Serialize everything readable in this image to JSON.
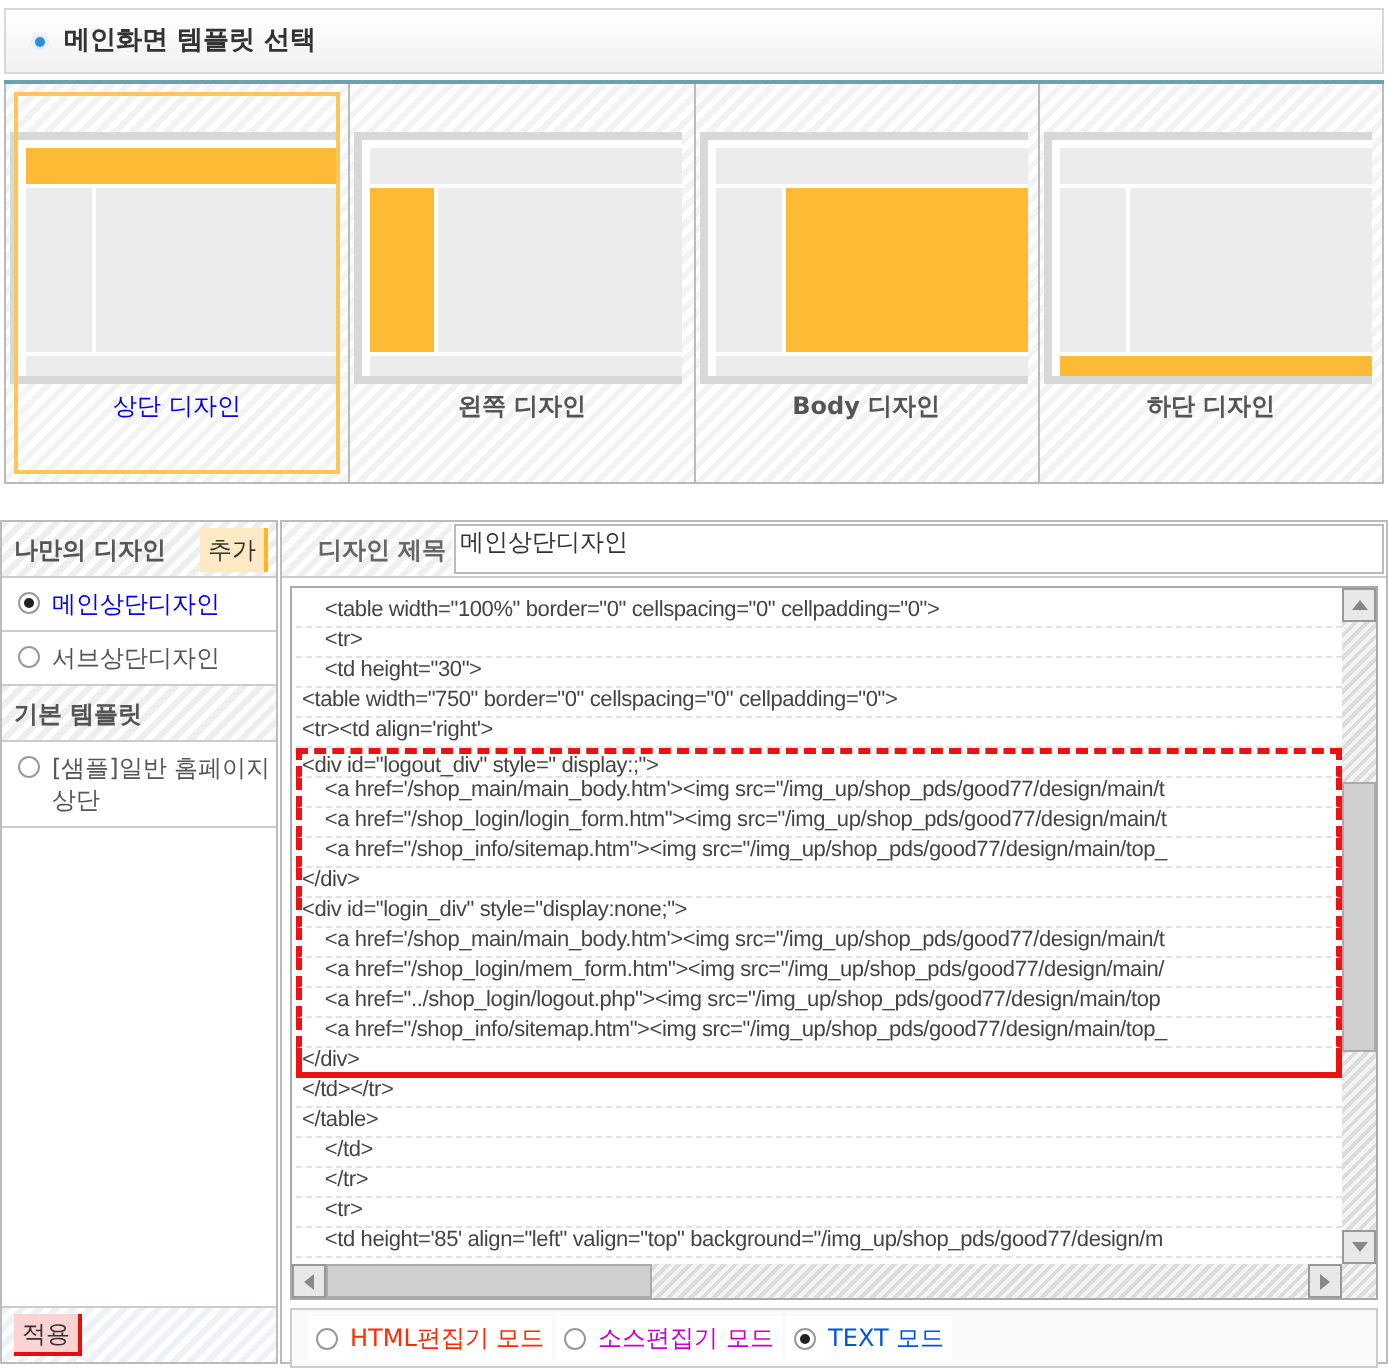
{
  "header": {
    "title": "메인화면 템플릿 선택"
  },
  "templates": [
    {
      "kind": "top",
      "label": "상단 디자인",
      "selected": true
    },
    {
      "kind": "left",
      "label": "왼쪽 디자인",
      "selected": false
    },
    {
      "kind": "body",
      "label": "Body 디자인",
      "selected": false
    },
    {
      "kind": "bottom",
      "label": "하단 디자인",
      "selected": false
    }
  ],
  "sidebar": {
    "my_designs": {
      "title": "나만의 디자인",
      "add_button": "추가",
      "items": [
        {
          "label": "메인상단디자인",
          "selected": true
        },
        {
          "label": "서브상단디자인",
          "selected": false
        }
      ]
    },
    "basic_templates": {
      "title": "기본 템플릿",
      "items": [
        {
          "label": "[샘플]일반 홈페이지 상단",
          "selected": false
        }
      ]
    },
    "apply_button": "적용"
  },
  "editor": {
    "title_label": "디자인 제목",
    "title_value": "메인상단디자인",
    "lines": [
      {
        "text": "    <table width=\"100%\" border=\"0\" cellspacing=\"0\" cellpadding=\"0\">",
        "highlighted": false
      },
      {
        "text": "    <tr>",
        "highlighted": false
      },
      {
        "text": "    <td height=\"30\">",
        "highlighted": false
      },
      {
        "text": "<table width=\"750\" border=\"0\" cellspacing=\"0\" cellpadding=\"0\">",
        "highlighted": false
      },
      {
        "text": "<tr><td align='right'>",
        "highlighted": false
      },
      {
        "text": "<div id=\"logout_div\" style=\" display:;\">",
        "highlighted": true
      },
      {
        "text": "    <a href='/shop_main/main_body.htm'><img src=\"/img_up/shop_pds/good77/design/main/t",
        "highlighted": true
      },
      {
        "text": "    <a href=\"/shop_login/login_form.htm\"><img src=\"/img_up/shop_pds/good77/design/main/t",
        "highlighted": true
      },
      {
        "text": "    <a href=\"/shop_info/sitemap.htm\"><img src=\"/img_up/shop_pds/good77/design/main/top_",
        "highlighted": true
      },
      {
        "text": "</div>",
        "highlighted": true
      },
      {
        "text": "<div id=\"login_div\" style=\"display:none;\">",
        "highlighted": true
      },
      {
        "text": "    <a href='/shop_main/main_body.htm'><img src=\"/img_up/shop_pds/good77/design/main/t",
        "highlighted": true
      },
      {
        "text": "    <a href=\"/shop_login/mem_form.htm\"><img src=\"/img_up/shop_pds/good77/design/main/",
        "highlighted": true
      },
      {
        "text": "    <a href=\"../shop_login/logout.php\"><img src=\"/img_up/shop_pds/good77/design/main/top",
        "highlighted": true
      },
      {
        "text": "    <a href=\"/shop_info/sitemap.htm\"><img src=\"/img_up/shop_pds/good77/design/main/top_",
        "highlighted": true
      },
      {
        "text": "</div>",
        "highlighted": true
      },
      {
        "text": "</td></tr>",
        "highlighted": false
      },
      {
        "text": "</table>",
        "highlighted": false
      },
      {
        "text": "    </td>",
        "highlighted": false
      },
      {
        "text": "    </tr>",
        "highlighted": false
      },
      {
        "text": "    <tr>",
        "highlighted": false
      },
      {
        "text": "    <td height='85' align=\"left\" valign=\"top\" background=\"/img_up/shop_pds/good77/design/m",
        "highlighted": false
      }
    ],
    "modes": [
      {
        "label": "HTML편집기 모드",
        "color": "#ff2a00",
        "selected": false
      },
      {
        "label": "소스편집기 모드",
        "color": "#cc00cc",
        "selected": false
      },
      {
        "label": "TEXT 모드",
        "color": "#0055dd",
        "selected": true
      }
    ]
  }
}
